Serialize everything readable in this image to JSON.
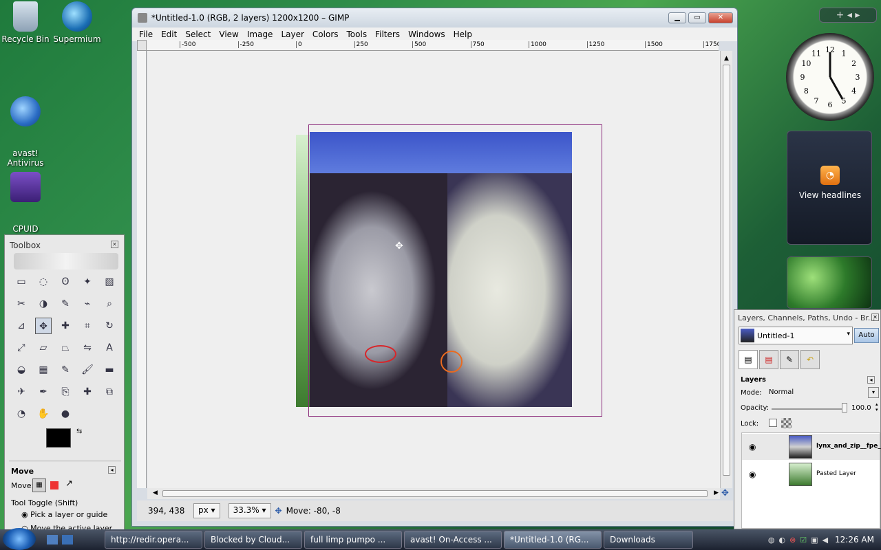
{
  "desktop": {
    "icons": [
      {
        "label": "Recycle Bin"
      },
      {
        "label": "Supermium"
      },
      {
        "label": "avast!\nAntivirus"
      },
      {
        "label": "CPUID\nCPU-Z"
      }
    ]
  },
  "gimp": {
    "title": "*Untitled-1.0 (RGB, 2 layers) 1200x1200 – GIMP",
    "menus": [
      "File",
      "Edit",
      "Select",
      "View",
      "Image",
      "Layer",
      "Colors",
      "Tools",
      "Filters",
      "Windows",
      "Help"
    ],
    "ruler_h_ticks": [
      "-500",
      "-250",
      "0",
      "250",
      "500",
      "750",
      "1000",
      "1250",
      "1500",
      "1750"
    ],
    "status": {
      "coords": "394, 438",
      "unit": "px",
      "zoom": "33.3%",
      "message": "Move: -80, -8"
    }
  },
  "toolbox": {
    "title": "Toolbox",
    "options_title": "Move",
    "move_label": "Move:",
    "tool_toggle": "Tool Toggle  (Shift)",
    "radio1": "Pick a layer or guide",
    "radio2": "Move the active layer"
  },
  "layers_dock": {
    "title": "Layers, Channels, Paths, Undo - Br...",
    "image_select": "Untitled-1",
    "auto_button": "Auto",
    "section": "Layers",
    "mode_label": "Mode:",
    "mode_value": "Normal",
    "opacity_label": "Opacity:",
    "opacity_value": "100.0",
    "lock_label": "Lock:",
    "layers": [
      {
        "name": "lynx_and_zip__fpe_o",
        "bold": true
      },
      {
        "name": "Pasted Layer",
        "bold": false
      }
    ]
  },
  "gadgets": {
    "feed_label": "View headlines",
    "clock_numbers": [
      "12",
      "1",
      "2",
      "3",
      "4",
      "5",
      "6",
      "7",
      "8",
      "9",
      "10",
      "11"
    ]
  },
  "taskbar": {
    "items": [
      {
        "label": "http://redir.opera...",
        "active": false
      },
      {
        "label": "Blocked by Cloud...",
        "active": false
      },
      {
        "label": "full limp pumpo ...",
        "active": false
      },
      {
        "label": "avast! On-Access ...",
        "active": false
      },
      {
        "label": "*Untitled-1.0 (RG...",
        "active": true
      },
      {
        "label": "Downloads",
        "active": false
      }
    ],
    "time": "12:26 AM"
  }
}
